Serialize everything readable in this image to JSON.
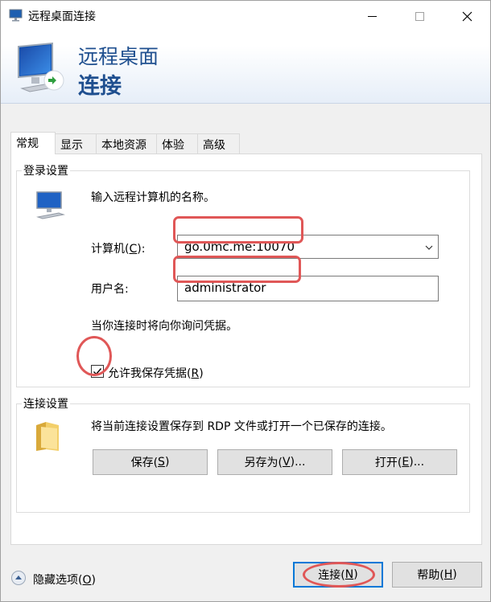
{
  "window": {
    "title": "远程桌面连接",
    "icons": {
      "app": "remote-desktop-icon",
      "minimize": "minimize-icon",
      "maximize": "maximize-icon",
      "close": "close-icon"
    }
  },
  "banner": {
    "line1": "远程桌面",
    "line2": "连接",
    "icon": "remote-desktop-monitor-icon"
  },
  "tabs": [
    "常规",
    "显示",
    "本地资源",
    "体验",
    "高级"
  ],
  "active_tab": "常规",
  "login_settings": {
    "group_label": "登录设置",
    "instruction": "输入远程计算机的名称。",
    "computer_label_pre": "计算机(",
    "computer_label_key": "C",
    "computer_label_post": "):",
    "computer_value": "go.0mc.me:10070",
    "username_label": "用户名:",
    "username_value": "administrator",
    "prompt_note": "当你连接时将向你询问凭据。",
    "save_credentials_pre": "允许我保存凭据(",
    "save_credentials_key": "R",
    "save_credentials_post": ")",
    "save_credentials_checked": true
  },
  "connection_settings": {
    "group_label": "连接设置",
    "description": "将当前连接设置保存到 RDP 文件或打开一个已保存的连接。",
    "save_pre": "保存(",
    "save_key": "S",
    "save_post": ")",
    "save_as_pre": "另存为(",
    "save_as_key": "V",
    "save_as_post": ")...",
    "open_pre": "打开(",
    "open_key": "E",
    "open_post": ")..."
  },
  "footer": {
    "hide_options_pre": "隐藏选项(",
    "hide_options_key": "O",
    "hide_options_post": ")",
    "connect_pre": "连接(",
    "connect_key": "N",
    "connect_post": ")",
    "help_pre": "帮助(",
    "help_key": "H",
    "help_post": ")"
  },
  "colors": {
    "accent": "#0078d7",
    "annotation": "#e05757",
    "banner_text": "#1f4f8f"
  }
}
